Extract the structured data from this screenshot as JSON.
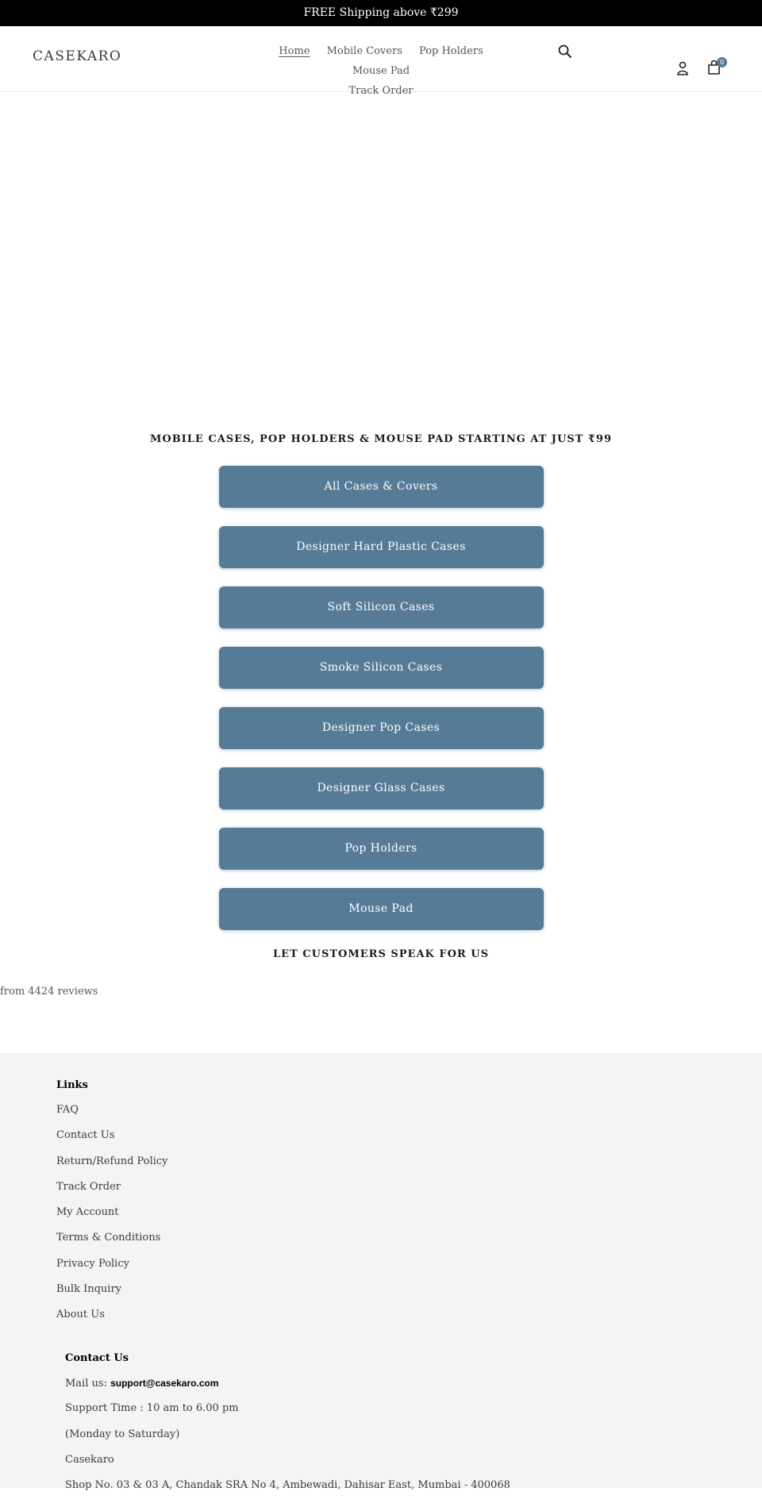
{
  "announcement": {
    "text": "FREE Shipping above ₹299"
  },
  "header": {
    "logo": "CASEKARO",
    "nav": [
      {
        "label": "Home",
        "active": true
      },
      {
        "label": "Mobile Covers",
        "active": false
      },
      {
        "label": "Pop Holders",
        "active": false
      },
      {
        "label": "Mouse Pad",
        "active": false
      },
      {
        "label": "Track Order",
        "active": false
      }
    ],
    "icons": {
      "search": "search-icon",
      "account": "account-icon",
      "cart": "cart-icon"
    },
    "cart_count": "0"
  },
  "main": {
    "tagline": "MOBILE CASES, POP HOLDERS & MOUSE PAD STARTING AT JUST ₹99",
    "categories": [
      "All Cases & Covers",
      "Designer Hard Plastic Cases",
      "Soft Silicon Cases",
      "Smoke Silicon Cases",
      "Designer Pop Cases",
      "Designer Glass Cases",
      "Pop Holders",
      "Mouse Pad"
    ],
    "reviews_title": "LET CUSTOMERS SPEAK FOR US",
    "reviews_count": "from 4424 reviews"
  },
  "footer": {
    "links_title": "Links",
    "links": [
      "FAQ",
      "Contact Us",
      "Return/Refund Policy",
      "Track Order",
      "My Account",
      "Terms & Conditions",
      "Privacy Policy",
      "Bulk Inquiry",
      "About Us"
    ],
    "contact_title": "Contact Us",
    "mail_label": "Mail us: ",
    "email": "support@casekaro.com",
    "support_time": "Support Time : 10 am to 6.00 pm",
    "support_days": "(Monday to Saturday)",
    "company": "Casekaro",
    "address": "Shop No. 03 & 03 A, Chandak SRA No 4, Ambewadi, Dahisar East, Mumbai - 400068"
  },
  "colors": {
    "accent": "#557b97",
    "announcement_bg": "#000000",
    "footer_bg": "#f4f4f4"
  }
}
